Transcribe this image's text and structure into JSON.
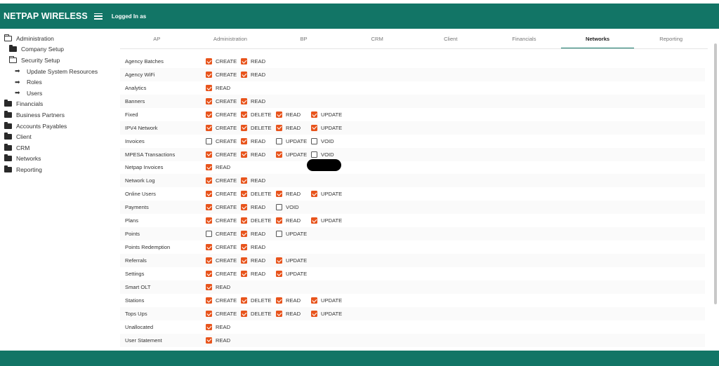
{
  "header": {
    "brand": "NETPAP WIRELESS",
    "logged_in": "Logged In as",
    "accent": "#127566"
  },
  "sidebar": {
    "items": [
      {
        "label": "Administration",
        "level": 0,
        "icon": "folder-open"
      },
      {
        "label": "Company Setup",
        "level": 1,
        "icon": "folder"
      },
      {
        "label": "Security Setup",
        "level": 1,
        "icon": "folder-open"
      },
      {
        "label": "Update System Resources",
        "level": 2,
        "icon": "arrow-right"
      },
      {
        "label": "Roles",
        "level": 2,
        "icon": "arrow-right"
      },
      {
        "label": "Users",
        "level": 2,
        "icon": "arrow-right"
      },
      {
        "label": "Financials",
        "level": 0,
        "icon": "folder"
      },
      {
        "label": "Business Partners",
        "level": 0,
        "icon": "folder"
      },
      {
        "label": "Accounts Payables",
        "level": 0,
        "icon": "folder"
      },
      {
        "label": "Client",
        "level": 0,
        "icon": "folder"
      },
      {
        "label": "CRM",
        "level": 0,
        "icon": "folder"
      },
      {
        "label": "Networks",
        "level": 0,
        "icon": "folder"
      },
      {
        "label": "Reporting",
        "level": 0,
        "icon": "folder"
      }
    ]
  },
  "tabs": [
    "AP",
    "Administration",
    "BP",
    "CRM",
    "Client",
    "Financials",
    "Networks",
    "Reporting"
  ],
  "active_tab": "Networks",
  "checkbox_color": "#e8541c",
  "permissions": [
    {
      "name": "Agency Batches",
      "ops": [
        [
          "CREATE",
          true
        ],
        [
          "READ",
          true
        ]
      ]
    },
    {
      "name": "Agency WiFi",
      "ops": [
        [
          "CREATE",
          true
        ],
        [
          "READ",
          true
        ]
      ]
    },
    {
      "name": "Analytics",
      "ops": [
        [
          "READ",
          true
        ]
      ]
    },
    {
      "name": "Banners",
      "ops": [
        [
          "CREATE",
          true
        ],
        [
          "READ",
          true
        ]
      ]
    },
    {
      "name": "Fixed",
      "ops": [
        [
          "CREATE",
          true
        ],
        [
          "DELETE",
          true
        ],
        [
          "READ",
          true
        ],
        [
          "UPDATE",
          true
        ]
      ]
    },
    {
      "name": "IPV4 Network",
      "ops": [
        [
          "CREATE",
          true
        ],
        [
          "DELETE",
          true
        ],
        [
          "READ",
          true
        ],
        [
          "UPDATE",
          true
        ]
      ]
    },
    {
      "name": "Invoices",
      "ops": [
        [
          "CREATE",
          false
        ],
        [
          "READ",
          true
        ],
        [
          "UPDATE",
          false
        ],
        [
          "VOID",
          false
        ]
      ]
    },
    {
      "name": "MPESA Transactions",
      "ops": [
        [
          "CREATE",
          true
        ],
        [
          "READ",
          true
        ],
        [
          "UPDATE",
          true
        ],
        [
          "VOID",
          false
        ]
      ]
    },
    {
      "name": "Netpap Invoices",
      "ops": [
        [
          "READ",
          true
        ]
      ]
    },
    {
      "name": "Network Log",
      "ops": [
        [
          "CREATE",
          true
        ],
        [
          "READ",
          true
        ]
      ]
    },
    {
      "name": "Online Users",
      "ops": [
        [
          "CREATE",
          true
        ],
        [
          "DELETE",
          true
        ],
        [
          "READ",
          true
        ],
        [
          "UPDATE",
          true
        ]
      ]
    },
    {
      "name": "Payments",
      "ops": [
        [
          "CREATE",
          true
        ],
        [
          "READ",
          true
        ],
        [
          "VOID",
          false
        ]
      ]
    },
    {
      "name": "Plans",
      "ops": [
        [
          "CREATE",
          true
        ],
        [
          "DELETE",
          true
        ],
        [
          "READ",
          true
        ],
        [
          "UPDATE",
          true
        ]
      ]
    },
    {
      "name": "Points",
      "ops": [
        [
          "CREATE",
          false
        ],
        [
          "READ",
          true
        ],
        [
          "UPDATE",
          false
        ]
      ]
    },
    {
      "name": "Points Redemption",
      "ops": [
        [
          "CREATE",
          true
        ],
        [
          "READ",
          true
        ]
      ]
    },
    {
      "name": "Referrals",
      "ops": [
        [
          "CREATE",
          true
        ],
        [
          "READ",
          true
        ],
        [
          "UPDATE",
          true
        ]
      ]
    },
    {
      "name": "Settings",
      "ops": [
        [
          "CREATE",
          true
        ],
        [
          "READ",
          true
        ],
        [
          "UPDATE",
          true
        ]
      ]
    },
    {
      "name": "Smart OLT",
      "ops": [
        [
          "READ",
          true
        ]
      ]
    },
    {
      "name": "Stations",
      "ops": [
        [
          "CREATE",
          true
        ],
        [
          "DELETE",
          true
        ],
        [
          "READ",
          true
        ],
        [
          "UPDATE",
          true
        ]
      ]
    },
    {
      "name": "Tops Ups",
      "ops": [
        [
          "CREATE",
          true
        ],
        [
          "DELETE",
          true
        ],
        [
          "READ",
          true
        ],
        [
          "UPDATE",
          true
        ]
      ]
    },
    {
      "name": "Unallocated",
      "ops": [
        [
          "READ",
          true
        ]
      ]
    },
    {
      "name": "User Statement",
      "ops": [
        [
          "READ",
          true
        ]
      ]
    }
  ]
}
